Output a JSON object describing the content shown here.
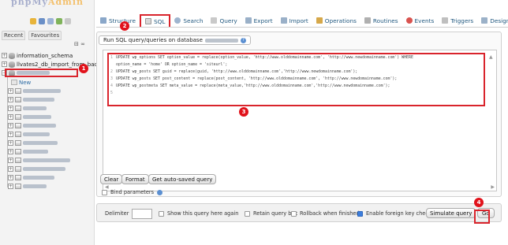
{
  "nav": {
    "tabs": [
      "Recent",
      "Favourites"
    ],
    "collapse_link": "⊟ ∞",
    "databases": [
      "information_schema",
      "llvates2_db_import_from_backup"
    ],
    "new_label": "New"
  },
  "toolbar": {
    "tabs": [
      {
        "label": "Structure",
        "icon": "structure-icon"
      },
      {
        "label": "SQL",
        "icon": "sql-icon"
      },
      {
        "label": "Search",
        "icon": "search-icon"
      },
      {
        "label": "Query",
        "icon": "query-icon"
      },
      {
        "label": "Export",
        "icon": "export-icon"
      },
      {
        "label": "Import",
        "icon": "import-icon"
      },
      {
        "label": "Operations",
        "icon": "operations-icon"
      },
      {
        "label": "Routines",
        "icon": "routines-icon"
      },
      {
        "label": "Events",
        "icon": "events-icon"
      },
      {
        "label": "Triggers",
        "icon": "triggers-icon"
      },
      {
        "label": "Designer",
        "icon": "designer-icon"
      }
    ]
  },
  "sql_panel": {
    "legend": "Run SQL query/queries on database",
    "lines": [
      {
        "num": "1",
        "text": "UPDATE wp_options SET option_value = replace(option_value, 'http://www.olddomainname.com', 'http://www.newdomainname.com') WHERE"
      },
      {
        "num": "",
        "text": "option_name = 'home' OR option_name = 'siteurl';"
      },
      {
        "num": "2",
        "text": "UPDATE wp_posts SET guid = replace(guid, 'http://www.olddomainname.com','http://www.newdomainname.com');"
      },
      {
        "num": "3",
        "text": "UPDATE wp_posts SET post_content = replace(post_content, 'http://www.olddomainname.com', 'http://www.newdomainname.com');"
      },
      {
        "num": "4",
        "text": "UPDATE wp_postmeta SET meta_value = replace(meta_value,'http://www.olddomainname.com','http://www.newdomainname.com');"
      },
      {
        "num": "5",
        "text": ""
      }
    ],
    "buttons": {
      "clear": "Clear",
      "format": "Format",
      "auto_saved": "Get auto-saved query"
    },
    "bind_parameters": "Bind parameters"
  },
  "bottom": {
    "delimiter_label": "Delimiter",
    "delimiter_value": "",
    "show_again": "Show this query here again",
    "retain_box": "Retain query box",
    "rollback": "Rollback when finished",
    "foreign_keys": "Enable foreign key checks",
    "simulate": "Simulate query",
    "go": "Go"
  },
  "markers": [
    "1",
    "2",
    "3",
    "4"
  ],
  "colors": {
    "highlight": "#d9242c",
    "marker": "#e1121b",
    "link": "#235a81"
  }
}
